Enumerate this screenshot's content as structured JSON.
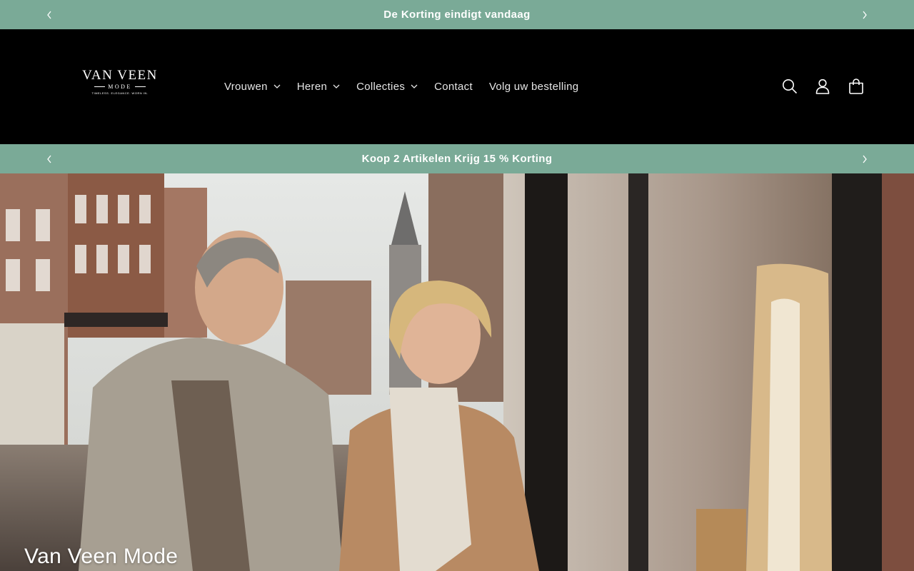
{
  "announcement_top": {
    "text": "De Korting eindigt vandaag",
    "prev_icon": "chevron-left-icon",
    "next_icon": "chevron-right-icon"
  },
  "header": {
    "logo": {
      "name": "VAN VEEN",
      "sub": "MODE",
      "tagline": "TIMELESS. ELEGANCE. WORN IN."
    },
    "nav": [
      {
        "label": "Vrouwen",
        "has_dropdown": true
      },
      {
        "label": "Heren",
        "has_dropdown": true
      },
      {
        "label": "Collecties",
        "has_dropdown": true
      },
      {
        "label": "Contact",
        "has_dropdown": false
      },
      {
        "label": "Volg uw bestelling",
        "has_dropdown": false
      }
    ],
    "icons": [
      "search-icon",
      "account-icon",
      "cart-icon"
    ]
  },
  "announcement_bottom": {
    "text": "Koop 2 Artikelen Krijg 15 % Korting",
    "prev_icon": "chevron-left-icon",
    "next_icon": "chevron-right-icon"
  },
  "hero": {
    "title": "Van Veen Mode"
  },
  "colors": {
    "announcement_bg": "#7aaa97",
    "header_bg": "#000000",
    "text_light": "#ffffff"
  }
}
